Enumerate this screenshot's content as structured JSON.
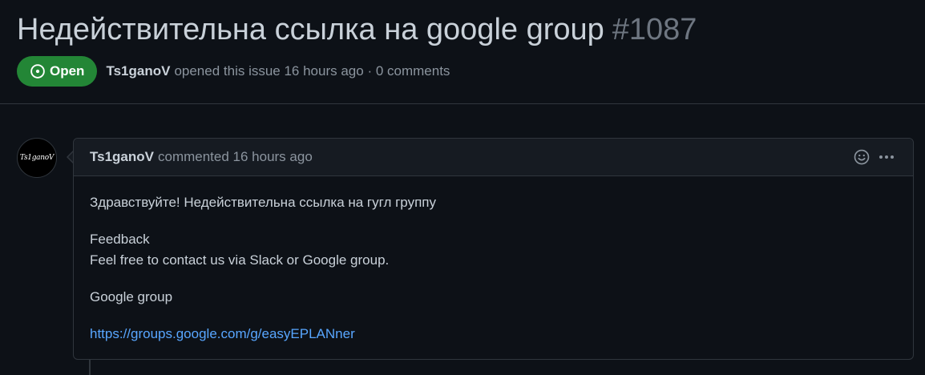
{
  "issue": {
    "title": "Недействительна ссылка на google group",
    "number": "#1087",
    "state_label": "Open",
    "state_color": "#238636",
    "author": "Ts1ganoV",
    "opened_text": "opened this issue 16 hours ago · 0 comments"
  },
  "comment": {
    "avatar_text": "Ts1ganoV",
    "author": "Ts1ganoV",
    "time_text": "commented 16 hours ago",
    "actions": {
      "reaction_icon": "smiley-icon",
      "menu_icon": "kebab-horizontal-icon"
    },
    "body": {
      "line1": "Здравствуйте! Недействительна ссылка на гугл группу",
      "feedback_heading": "Feedback",
      "feedback_text": "Feel free to contact us via Slack or Google group.",
      "google_group_label": "Google group",
      "link_text": "https://groups.google.com/g/easyEPLANner"
    }
  },
  "colors": {
    "background": "#0d1117",
    "header_background": "#161b22",
    "border": "#30363d",
    "link": "#58a6ff",
    "muted_text": "#8b949e"
  }
}
